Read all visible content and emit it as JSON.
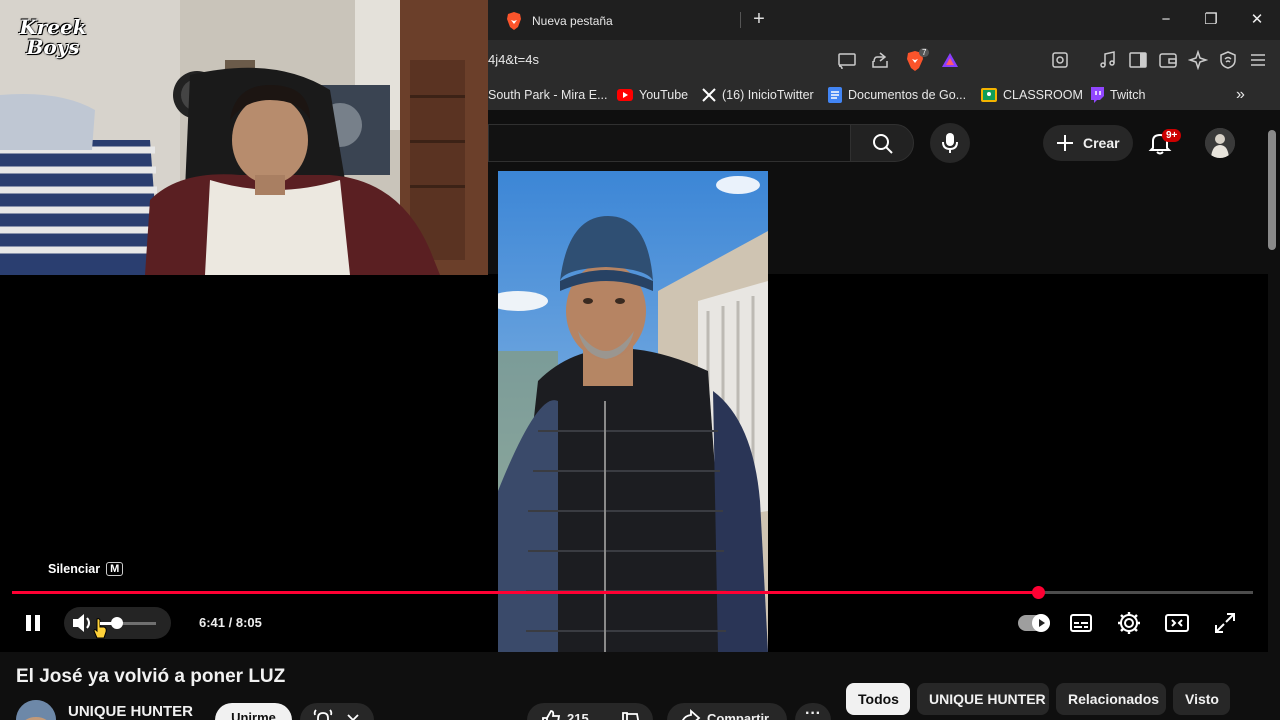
{
  "browser": {
    "tab_title": "Nueva pestaña",
    "new_tab_label": "+",
    "url_fragment": "4j4&t=4s",
    "minimize": "−",
    "maximize": "❐",
    "close": "✕",
    "bookmarks": [
      {
        "label": "South Park - Mira E...",
        "icon": "southpark-icon"
      },
      {
        "label": "YouTube",
        "icon": "youtube-icon"
      },
      {
        "label": "(16) InicioTwitter",
        "icon": "x-icon"
      },
      {
        "label": "Documentos de Go...",
        "icon": "docs-icon"
      },
      {
        "label": "CLASSROOM",
        "icon": "classroom-icon"
      },
      {
        "label": "Twitch",
        "icon": "twitch-icon"
      }
    ],
    "overflow": "»",
    "shield_count": "7"
  },
  "youtube_header": {
    "create_label": "Crear",
    "notification_badge": "9+"
  },
  "webcam": {
    "logo_text": "Kreek Boys"
  },
  "player": {
    "tooltip_label": "Silenciar",
    "tooltip_key": "M",
    "current_time": "6:41",
    "duration": "8:05",
    "time_display": "6:41 / 8:05",
    "progress_fraction": 0.827,
    "volume_fraction": 0.3
  },
  "video_info": {
    "title": "El José ya volvió a poner LUZ",
    "channel_name": "UNIQUE HUNTER",
    "join_label": "Unirme",
    "like_count": "215",
    "share_label": "Compartir",
    "more_label": "···"
  },
  "chips": [
    {
      "label": "Todos",
      "active": true
    },
    {
      "label": "UNIQUE HUNTER",
      "active": false
    },
    {
      "label": "Relacionados",
      "active": false
    },
    {
      "label": "Visto",
      "active": false
    }
  ],
  "colors": {
    "progress": "#ff0033",
    "background": "#0f0f0f",
    "chip_active": "#f1f1f1"
  }
}
